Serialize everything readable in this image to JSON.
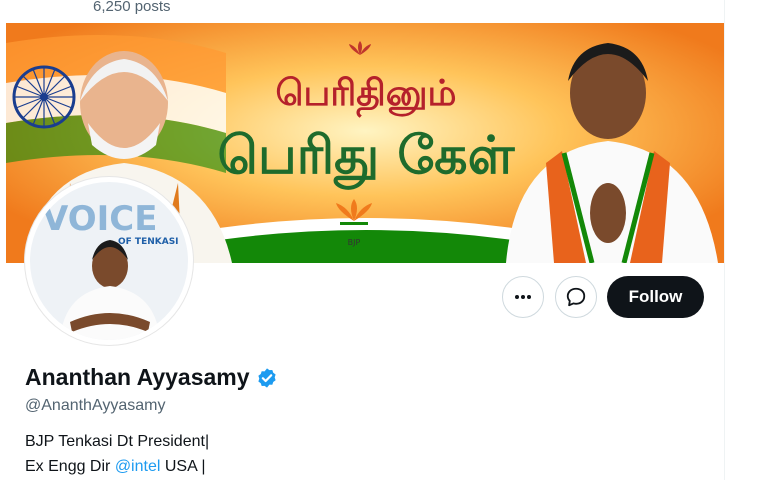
{
  "header": {
    "posts_count": "6,250 posts",
    "top_right_fragment": "··· ,··· ···"
  },
  "banner": {
    "headline_line1": "பெரிதினும்",
    "headline_line2": "பெரிது கேள்",
    "party_mark": "BJP"
  },
  "avatar": {
    "caption_big": "VOICE",
    "caption_small": "OF TENKASI"
  },
  "actions": {
    "follow_label": "Follow"
  },
  "profile": {
    "name": "Ananthan Ayyasamy",
    "handle": "@AnanthAyyasamy",
    "bio_line1": "BJP Tenkasi Dt President|",
    "bio_line2_prefix": "Ex Engg Dir ",
    "bio_line2_link": "@intel",
    "bio_line2_suffix": " USA |"
  },
  "colors": {
    "follow_bg": "#0f1419",
    "verified": "#1d9bf0",
    "link": "#1d9bf0",
    "muted": "#536471",
    "banner_orange": "#f08a24",
    "saffron": "#ff9933",
    "green": "#138808"
  },
  "icons": [
    "more-icon",
    "message-icon",
    "verified-badge-icon",
    "lotus-icon",
    "ashoka-chakra-icon"
  ]
}
